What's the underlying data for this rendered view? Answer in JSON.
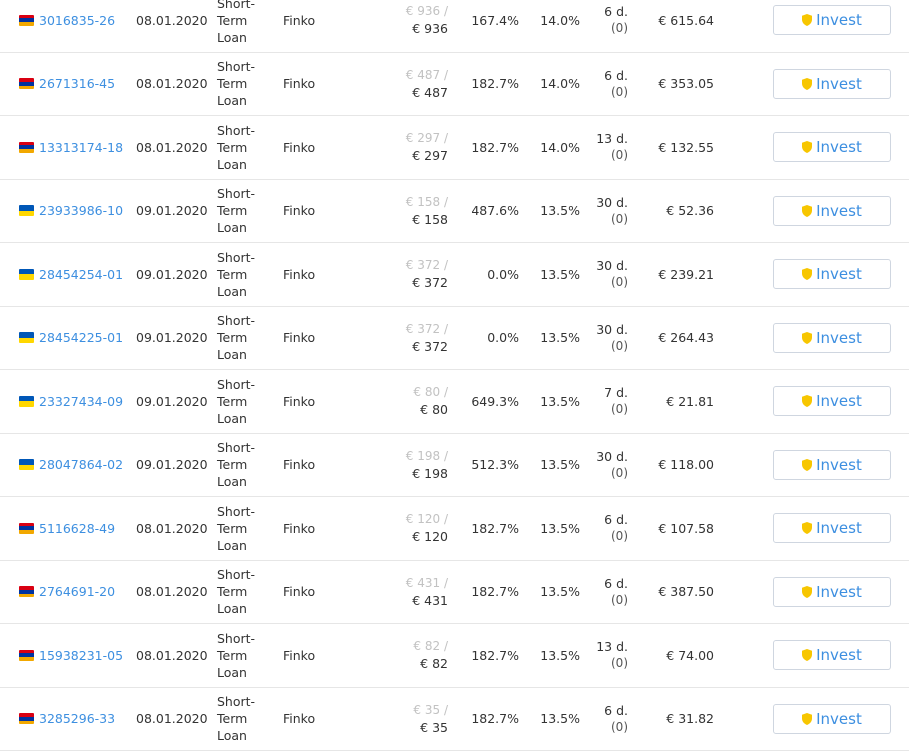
{
  "colors": {
    "link": "#3d8fe0",
    "shield": "#f7c600",
    "muted": "#c2c2c2",
    "divider": "#e6e6e6"
  },
  "invest_label": "Invest",
  "rows": [
    {
      "flag": "armenia-flag-icon",
      "id": "3016835-26",
      "date": "08.01.2020",
      "type": "Short-\nTerm\nLoan",
      "originator": "Finko",
      "amount_available": "€ 936 /",
      "amount_total": "€ 936",
      "interest": "167.4%",
      "rate": "14.0%",
      "term": "6 d.",
      "term_ext": "(0)",
      "available": "€ 615.64"
    },
    {
      "flag": "armenia-flag-icon",
      "id": "2671316-45",
      "date": "08.01.2020",
      "type": "Short-\nTerm\nLoan",
      "originator": "Finko",
      "amount_available": "€ 487 /",
      "amount_total": "€ 487",
      "interest": "182.7%",
      "rate": "14.0%",
      "term": "6 d.",
      "term_ext": "(0)",
      "available": "€ 353.05"
    },
    {
      "flag": "armenia-flag-icon",
      "id": "13313174-18",
      "date": "08.01.2020",
      "type": "Short-\nTerm\nLoan",
      "originator": "Finko",
      "amount_available": "€ 297 /",
      "amount_total": "€ 297",
      "interest": "182.7%",
      "rate": "14.0%",
      "term": "13 d.",
      "term_ext": "(0)",
      "available": "€ 132.55"
    },
    {
      "flag": "ukraine-flag-icon",
      "id": "23933986-10",
      "date": "09.01.2020",
      "type": "Short-\nTerm\nLoan",
      "originator": "Finko",
      "amount_available": "€ 158 /",
      "amount_total": "€ 158",
      "interest": "487.6%",
      "rate": "13.5%",
      "term": "30 d.",
      "term_ext": "(0)",
      "available": "€ 52.36"
    },
    {
      "flag": "ukraine-flag-icon",
      "id": "28454254-01",
      "date": "09.01.2020",
      "type": "Short-\nTerm\nLoan",
      "originator": "Finko",
      "amount_available": "€ 372 /",
      "amount_total": "€ 372",
      "interest": "0.0%",
      "rate": "13.5%",
      "term": "30 d.",
      "term_ext": "(0)",
      "available": "€ 239.21"
    },
    {
      "flag": "ukraine-flag-icon",
      "id": "28454225-01",
      "date": "09.01.2020",
      "type": "Short-\nTerm\nLoan",
      "originator": "Finko",
      "amount_available": "€ 372 /",
      "amount_total": "€ 372",
      "interest": "0.0%",
      "rate": "13.5%",
      "term": "30 d.",
      "term_ext": "(0)",
      "available": "€ 264.43"
    },
    {
      "flag": "ukraine-flag-icon",
      "id": "23327434-09",
      "date": "09.01.2020",
      "type": "Short-\nTerm\nLoan",
      "originator": "Finko",
      "amount_available": "€ 80 /",
      "amount_total": "€ 80",
      "interest": "649.3%",
      "rate": "13.5%",
      "term": "7 d.",
      "term_ext": "(0)",
      "available": "€ 21.81"
    },
    {
      "flag": "ukraine-flag-icon",
      "id": "28047864-02",
      "date": "09.01.2020",
      "type": "Short-\nTerm\nLoan",
      "originator": "Finko",
      "amount_available": "€ 198 /",
      "amount_total": "€ 198",
      "interest": "512.3%",
      "rate": "13.5%",
      "term": "30 d.",
      "term_ext": "(0)",
      "available": "€ 118.00"
    },
    {
      "flag": "armenia-flag-icon",
      "id": "5116628-49",
      "date": "08.01.2020",
      "type": "Short-\nTerm\nLoan",
      "originator": "Finko",
      "amount_available": "€ 120 /",
      "amount_total": "€ 120",
      "interest": "182.7%",
      "rate": "13.5%",
      "term": "6 d.",
      "term_ext": "(0)",
      "available": "€ 107.58"
    },
    {
      "flag": "armenia-flag-icon",
      "id": "2764691-20",
      "date": "08.01.2020",
      "type": "Short-\nTerm\nLoan",
      "originator": "Finko",
      "amount_available": "€ 431 /",
      "amount_total": "€ 431",
      "interest": "182.7%",
      "rate": "13.5%",
      "term": "6 d.",
      "term_ext": "(0)",
      "available": "€ 387.50"
    },
    {
      "flag": "armenia-flag-icon",
      "id": "15938231-05",
      "date": "08.01.2020",
      "type": "Short-\nTerm\nLoan",
      "originator": "Finko",
      "amount_available": "€ 82 /",
      "amount_total": "€ 82",
      "interest": "182.7%",
      "rate": "13.5%",
      "term": "13 d.",
      "term_ext": "(0)",
      "available": "€ 74.00"
    },
    {
      "flag": "armenia-flag-icon",
      "id": "3285296-33",
      "date": "08.01.2020",
      "type": "Short-\nTerm\nLoan",
      "originator": "Finko",
      "amount_available": "€ 35 /",
      "amount_total": "€ 35",
      "interest": "182.7%",
      "rate": "13.5%",
      "term": "6 d.",
      "term_ext": "(0)",
      "available": "€ 31.82"
    }
  ]
}
